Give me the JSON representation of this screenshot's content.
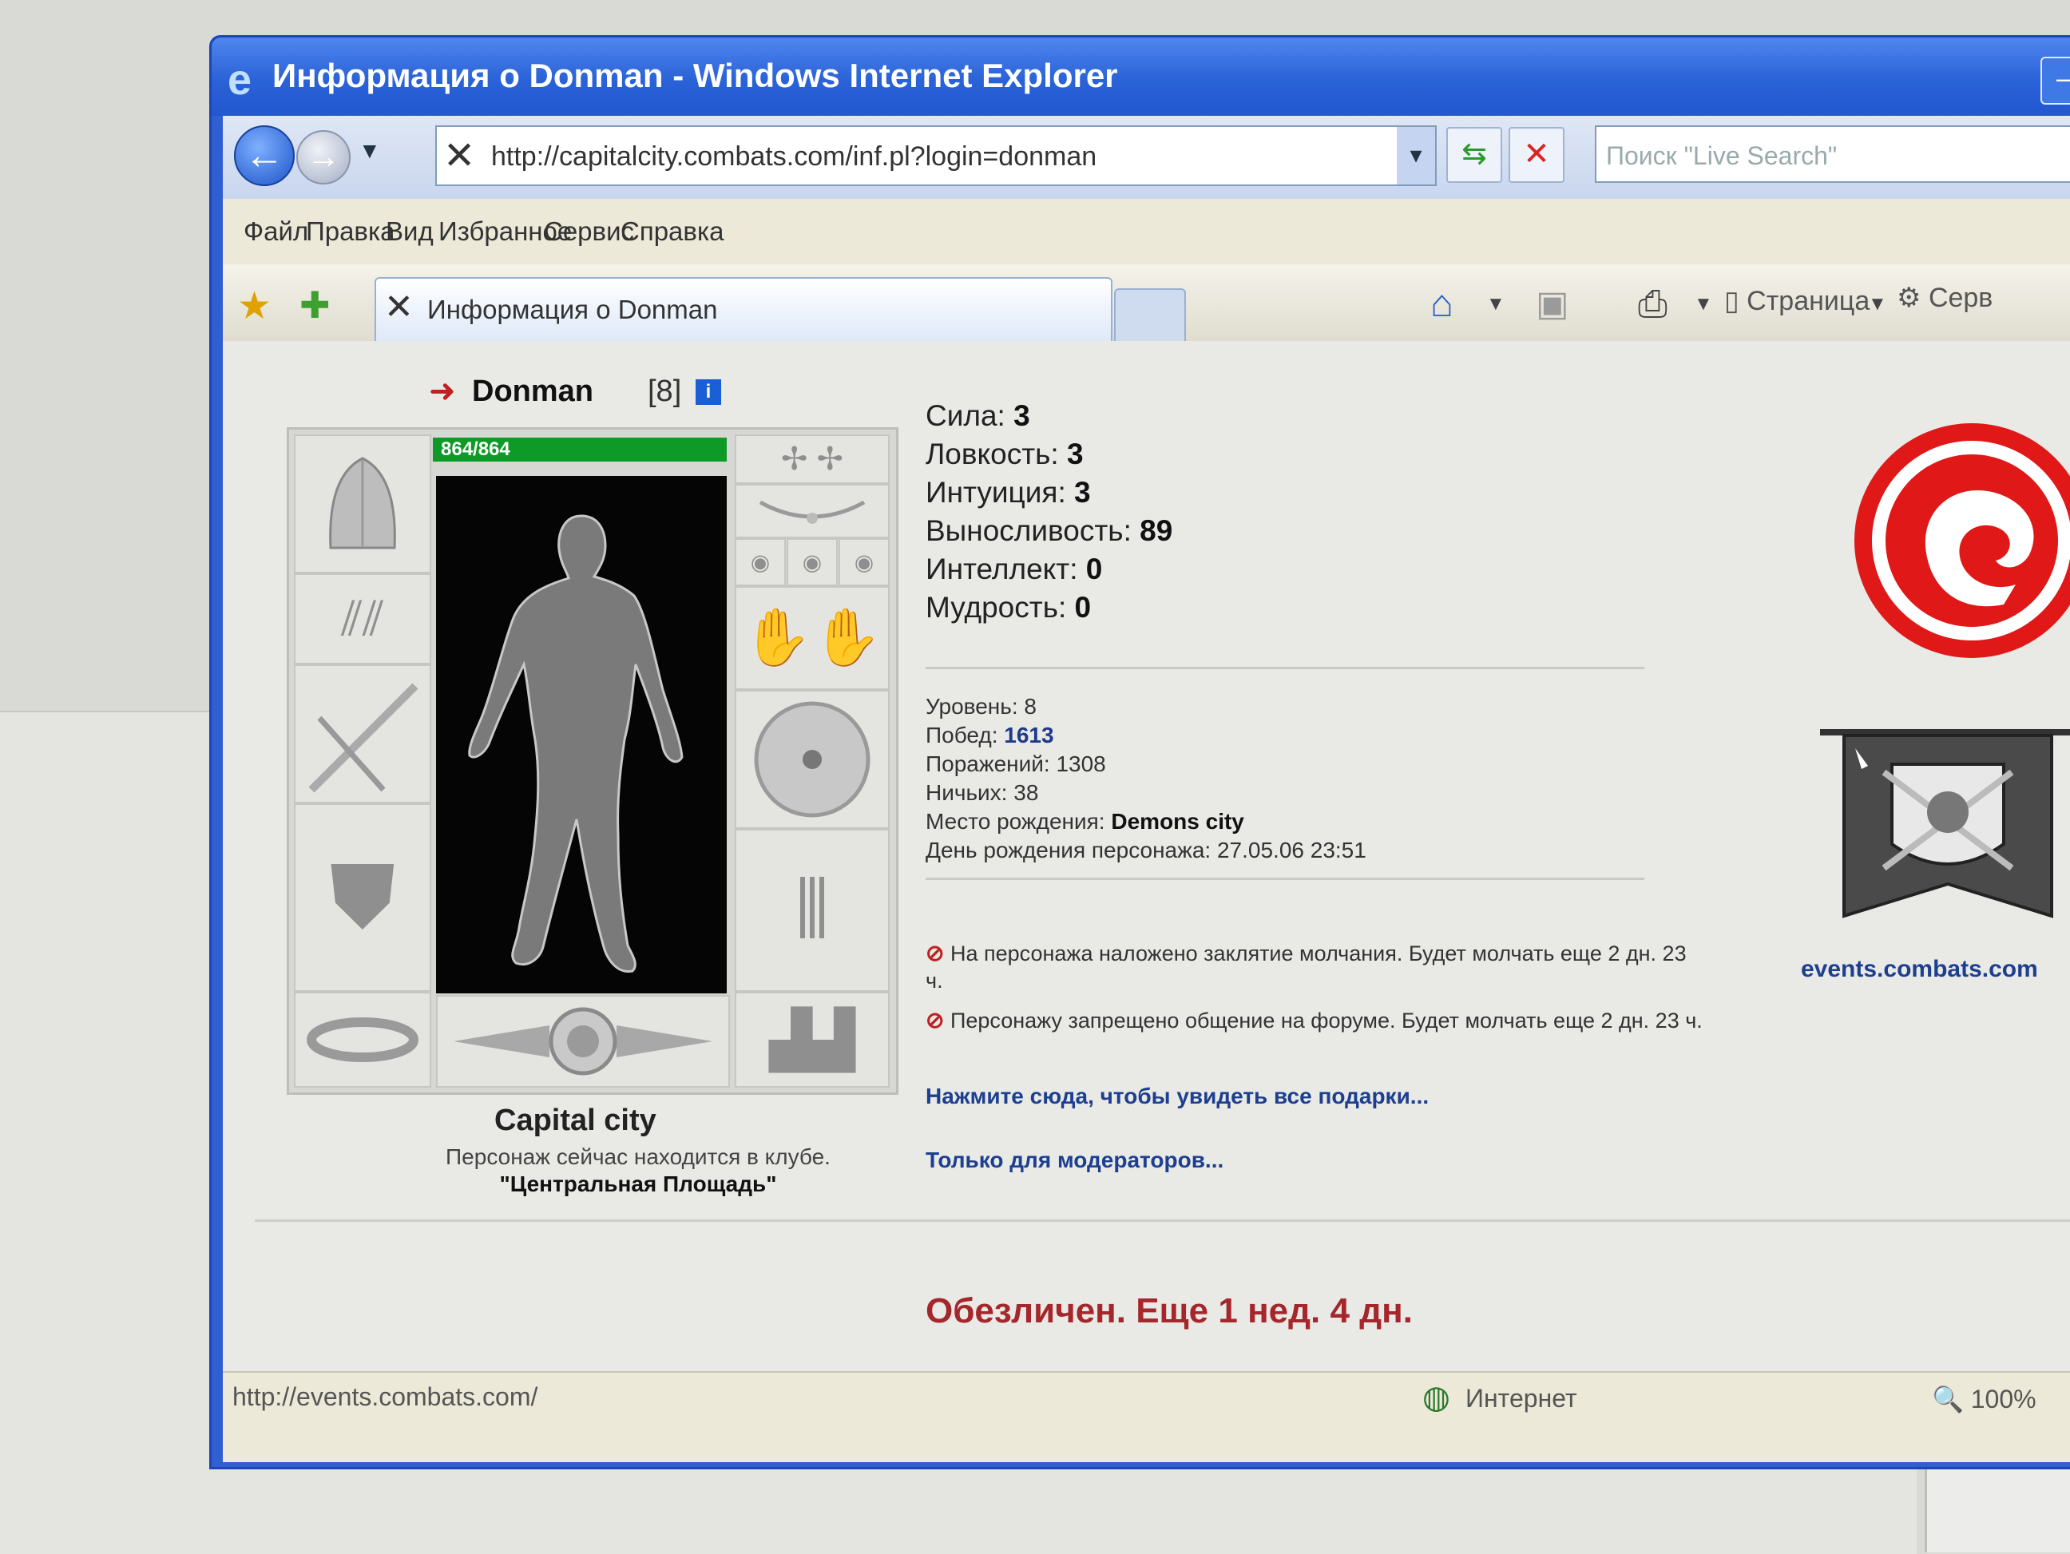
{
  "window": {
    "title": "Информация о Donman - Windows Internet Explorer"
  },
  "addressbar": {
    "url": "http://capitalcity.combats.com/inf.pl?login=donman",
    "search_placeholder": "Поиск \"Live Search\""
  },
  "menu": {
    "items": [
      "Файл",
      "Правка",
      "Вид",
      "Избранное",
      "Сервис",
      "Справка"
    ]
  },
  "tabs": {
    "active_label": "Информация о Donman"
  },
  "toolbar": {
    "page_label": "Страница",
    "service_label": "Серв"
  },
  "character": {
    "name": "Donman",
    "level_display": "[8]",
    "info_icon_glyph": "i",
    "hp": "864/864",
    "city": "Capital city",
    "location_note": "Персонаж сейчас находится в клубе.",
    "location_room": "\"Центральная Площадь\""
  },
  "stats": [
    {
      "label": "Сила:",
      "value": "3"
    },
    {
      "label": "Ловкость:",
      "value": "3"
    },
    {
      "label": "Интуиция:",
      "value": "3"
    },
    {
      "label": "Выносливость:",
      "value": "89"
    },
    {
      "label": "Интеллект:",
      "value": "0"
    },
    {
      "label": "Мудрость:",
      "value": "0"
    }
  ],
  "record": {
    "level_label": "Уровень:",
    "level_value": "8",
    "wins_label": "Побед:",
    "wins_value": "1613",
    "losses_label": "Поражений:",
    "losses_value": "1308",
    "draws_label": "Ничьих:",
    "draws_value": "38",
    "birthplace_label": "Место рождения:",
    "birthplace_value": "Demons city",
    "birthday_label": "День рождения персонажа:",
    "birthday_value": "27.05.06 23:51"
  },
  "bans": [
    {
      "text": "На персонажа наложено заклятие молчания. Будет молчать еще 2 дн. 23 ч."
    },
    {
      "text": "Персонажу запрещено общение на форуме. Будет молчать еще 2 дн. 23 ч."
    }
  ],
  "links": {
    "gifts": "Нажмите сюда, чтобы увидеть все подарки...",
    "moderators": "Только для модераторов...",
    "events": "events.combats.com"
  },
  "depersonalized": "Обезличен. Еще 1 нед. 4 дн.",
  "statusbar": {
    "url": "http://events.combats.com/",
    "zone": "Интернет",
    "zoom": "100%"
  },
  "colors": {
    "titlebar": "#2a62d8",
    "hp_bar": "#0e9a26",
    "link": "#1d3f8f",
    "alert": "#a5262b",
    "emblem": "#e01818"
  }
}
